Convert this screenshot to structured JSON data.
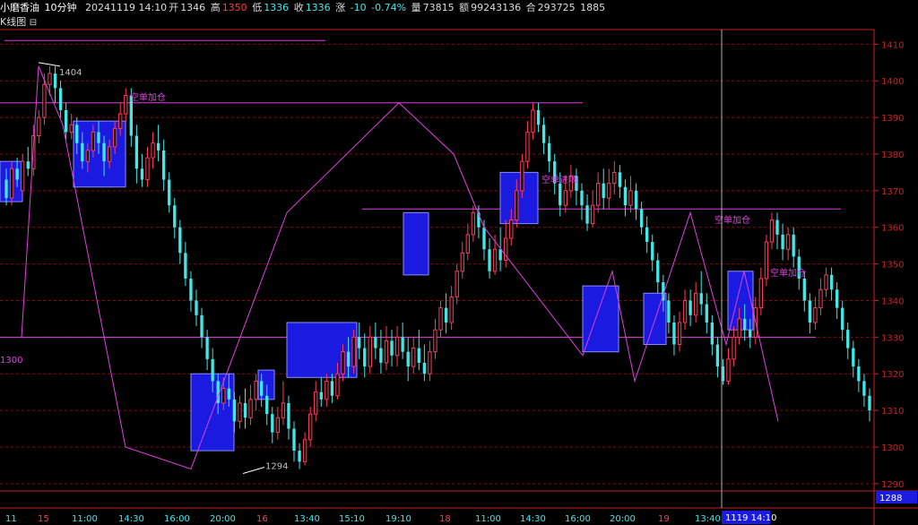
{
  "header": {
    "symbol": "小磨香油",
    "period": "10分钟",
    "datetime": "20241119 14:10",
    "open_label": "开",
    "open": "1346",
    "high_label": "高",
    "high": "1350",
    "low_label": "低",
    "low": "1336",
    "close_label": "收",
    "close": "1336",
    "change_label": "涨",
    "change": "-10",
    "change_pct": "-0.74%",
    "volume_label": "量",
    "volume": "73815",
    "amount_label": "额",
    "amount": "99243136",
    "oi_label": "合",
    "oi": "293725",
    "extra": "1885"
  },
  "subhead": {
    "title": "K线图",
    "icon": "window-icon"
  },
  "colors": {
    "up": "#ff3c5c",
    "down": "#40e8e8",
    "box_fill": "#1a1ae0",
    "box_edge": "#8c8cff",
    "magenta": "#e040e0",
    "axis": "#cc2222",
    "grid": "#7a1010",
    "text_grey": "#c0c0c0"
  },
  "chart_data": {
    "type": "candlestick",
    "title": "",
    "ylim": [
      1288,
      1414
    ],
    "yticks": [
      1290,
      1300,
      1310,
      1320,
      1330,
      1340,
      1350,
      1360,
      1370,
      1380,
      1390,
      1400,
      1410
    ],
    "current_price_label": "1288",
    "left_value_label": "1300",
    "xticks": [
      "11",
      "15",
      "11:00",
      "14:30",
      "16:00",
      "20:00",
      "16",
      "13:40",
      "15:10",
      "19:10",
      "18",
      "11:00",
      "14:30",
      "16:00",
      "20:00",
      "19",
      "13:40"
    ],
    "crosshair_label": "1119 14:10",
    "peak_labels": [
      {
        "text": "1404",
        "price": 1404
      },
      {
        "text": "1294",
        "price": 1294
      }
    ],
    "annotations": [
      "空单加仓",
      "空单进场",
      "空单加仓",
      "空单加仓"
    ],
    "horizontal_lines": [
      1411,
      1394,
      1365,
      1330
    ],
    "zigzag": [
      1330,
      1404,
      1388,
      1300,
      1294,
      1332,
      1364,
      1394,
      1380,
      1360,
      1325,
      1348,
      1318,
      1364,
      1328,
      1348,
      1307
    ],
    "boxes": [
      {
        "y_low": 1367,
        "y_high": 1378
      },
      {
        "y_low": 1371,
        "y_high": 1389
      },
      {
        "y_low": 1299,
        "y_high": 1320
      },
      {
        "y_low": 1313,
        "y_high": 1321
      },
      {
        "y_low": 1319,
        "y_high": 1334
      },
      {
        "y_low": 1347,
        "y_high": 1364
      },
      {
        "y_low": 1361,
        "y_high": 1375
      },
      {
        "y_low": 1326,
        "y_high": 1344
      },
      {
        "y_low": 1328,
        "y_high": 1342
      },
      {
        "y_low": 1332,
        "y_high": 1348
      }
    ],
    "candles": [
      [
        1373,
        1368,
        1376,
        1366
      ],
      [
        1368,
        1376,
        1378,
        1366
      ],
      [
        1376,
        1373,
        1379,
        1371
      ],
      [
        1370,
        1378,
        1380,
        1368
      ],
      [
        1378,
        1376,
        1382,
        1374
      ],
      [
        1376,
        1385,
        1388,
        1374
      ],
      [
        1385,
        1390,
        1392,
        1383
      ],
      [
        1390,
        1399,
        1402,
        1388
      ],
      [
        1399,
        1402,
        1404,
        1396
      ],
      [
        1402,
        1398,
        1404,
        1394
      ],
      [
        1398,
        1392,
        1400,
        1390
      ],
      [
        1392,
        1386,
        1394,
        1384
      ],
      [
        1386,
        1388,
        1391,
        1384
      ],
      [
        1388,
        1383,
        1390,
        1380
      ],
      [
        1383,
        1378,
        1386,
        1376
      ],
      [
        1378,
        1381,
        1383,
        1375
      ],
      [
        1381,
        1386,
        1388,
        1379
      ],
      [
        1386,
        1383,
        1389,
        1380
      ],
      [
        1383,
        1378,
        1385,
        1374
      ],
      [
        1378,
        1382,
        1384,
        1376
      ],
      [
        1382,
        1387,
        1389,
        1380
      ],
      [
        1387,
        1391,
        1394,
        1385
      ],
      [
        1391,
        1396,
        1398,
        1389
      ],
      [
        1396,
        1385,
        1398,
        1382
      ],
      [
        1385,
        1376,
        1388,
        1372
      ],
      [
        1376,
        1373,
        1380,
        1371
      ],
      [
        1373,
        1379,
        1382,
        1371
      ],
      [
        1379,
        1383,
        1386,
        1376
      ],
      [
        1383,
        1381,
        1388,
        1378
      ],
      [
        1381,
        1373,
        1384,
        1370
      ],
      [
        1373,
        1366,
        1375,
        1364
      ],
      [
        1366,
        1360,
        1368,
        1357
      ],
      [
        1360,
        1353,
        1362,
        1350
      ],
      [
        1353,
        1346,
        1356,
        1344
      ],
      [
        1346,
        1340,
        1348,
        1337
      ],
      [
        1340,
        1336,
        1343,
        1333
      ],
      [
        1336,
        1330,
        1338,
        1327
      ],
      [
        1330,
        1324,
        1332,
        1321
      ],
      [
        1324,
        1318,
        1327,
        1315
      ],
      [
        1318,
        1312,
        1320,
        1309
      ],
      [
        1312,
        1316,
        1319,
        1310
      ],
      [
        1316,
        1313,
        1320,
        1311
      ],
      [
        1313,
        1307,
        1315,
        1304
      ],
      [
        1307,
        1312,
        1314,
        1305
      ],
      [
        1312,
        1308,
        1316,
        1305
      ],
      [
        1308,
        1313,
        1317,
        1306
      ],
      [
        1313,
        1318,
        1320,
        1310
      ],
      [
        1318,
        1314,
        1320,
        1311
      ],
      [
        1314,
        1309,
        1317,
        1306
      ],
      [
        1309,
        1304,
        1311,
        1301
      ],
      [
        1304,
        1308,
        1311,
        1302
      ],
      [
        1308,
        1312,
        1318,
        1306
      ],
      [
        1312,
        1305,
        1314,
        1302
      ],
      [
        1305,
        1299,
        1307,
        1296
      ],
      [
        1299,
        1296,
        1301,
        1294
      ],
      [
        1296,
        1302,
        1304,
        1295
      ],
      [
        1302,
        1309,
        1311,
        1300
      ],
      [
        1309,
        1315,
        1318,
        1307
      ],
      [
        1315,
        1313,
        1319,
        1311
      ],
      [
        1313,
        1318,
        1320,
        1311
      ],
      [
        1318,
        1314,
        1320,
        1312
      ],
      [
        1314,
        1320,
        1323,
        1313
      ],
      [
        1320,
        1326,
        1328,
        1318
      ],
      [
        1326,
        1322,
        1330,
        1319
      ],
      [
        1322,
        1330,
        1332,
        1320
      ],
      [
        1330,
        1327,
        1334,
        1324
      ],
      [
        1327,
        1322,
        1331,
        1319
      ],
      [
        1322,
        1330,
        1333,
        1320
      ],
      [
        1330,
        1327,
        1334,
        1324
      ],
      [
        1327,
        1323,
        1332,
        1320
      ],
      [
        1323,
        1329,
        1333,
        1321
      ],
      [
        1329,
        1325,
        1332,
        1322
      ],
      [
        1325,
        1330,
        1333,
        1322
      ],
      [
        1330,
        1326,
        1334,
        1324
      ],
      [
        1326,
        1322,
        1330,
        1318
      ],
      [
        1322,
        1327,
        1330,
        1320
      ],
      [
        1327,
        1323,
        1332,
        1321
      ],
      [
        1323,
        1320,
        1328,
        1318
      ],
      [
        1320,
        1326,
        1329,
        1318
      ],
      [
        1326,
        1332,
        1335,
        1324
      ],
      [
        1332,
        1338,
        1340,
        1330
      ],
      [
        1338,
        1334,
        1342,
        1331
      ],
      [
        1334,
        1341,
        1344,
        1332
      ],
      [
        1341,
        1348,
        1350,
        1339
      ],
      [
        1348,
        1353,
        1356,
        1346
      ],
      [
        1353,
        1358,
        1361,
        1351
      ],
      [
        1358,
        1364,
        1366,
        1356
      ],
      [
        1364,
        1360,
        1366,
        1357
      ],
      [
        1360,
        1354,
        1362,
        1351
      ],
      [
        1354,
        1348,
        1357,
        1346
      ],
      [
        1348,
        1354,
        1358,
        1347
      ],
      [
        1354,
        1351,
        1360,
        1348
      ],
      [
        1351,
        1357,
        1362,
        1349
      ],
      [
        1357,
        1362,
        1365,
        1355
      ],
      [
        1362,
        1370,
        1373,
        1360
      ],
      [
        1370,
        1378,
        1380,
        1368
      ],
      [
        1378,
        1386,
        1389,
        1376
      ],
      [
        1386,
        1392,
        1394,
        1384
      ],
      [
        1392,
        1388,
        1394,
        1386
      ],
      [
        1388,
        1383,
        1390,
        1380
      ],
      [
        1383,
        1378,
        1385,
        1375
      ],
      [
        1378,
        1372,
        1380,
        1369
      ],
      [
        1372,
        1366,
        1375,
        1363
      ],
      [
        1366,
        1370,
        1374,
        1364
      ],
      [
        1370,
        1374,
        1377,
        1368
      ],
      [
        1374,
        1370,
        1376,
        1366
      ],
      [
        1370,
        1366,
        1372,
        1362
      ],
      [
        1366,
        1361,
        1369,
        1359
      ],
      [
        1361,
        1366,
        1370,
        1360
      ],
      [
        1366,
        1372,
        1375,
        1364
      ],
      [
        1372,
        1368,
        1376,
        1365
      ],
      [
        1368,
        1372,
        1376,
        1365
      ],
      [
        1372,
        1375,
        1378,
        1369
      ],
      [
        1375,
        1371,
        1377,
        1368
      ],
      [
        1371,
        1366,
        1373,
        1363
      ],
      [
        1366,
        1370,
        1374,
        1364
      ],
      [
        1370,
        1365,
        1372,
        1362
      ],
      [
        1365,
        1360,
        1367,
        1358
      ],
      [
        1360,
        1356,
        1363,
        1353
      ],
      [
        1356,
        1351,
        1358,
        1348
      ],
      [
        1351,
        1345,
        1353,
        1342
      ],
      [
        1345,
        1340,
        1347,
        1337
      ],
      [
        1340,
        1334,
        1342,
        1331
      ],
      [
        1334,
        1328,
        1336,
        1325
      ],
      [
        1328,
        1334,
        1337,
        1326
      ],
      [
        1334,
        1340,
        1343,
        1332
      ],
      [
        1340,
        1336,
        1343,
        1333
      ],
      [
        1336,
        1342,
        1345,
        1334
      ],
      [
        1342,
        1339,
        1348,
        1336
      ],
      [
        1339,
        1334,
        1342,
        1331
      ],
      [
        1334,
        1328,
        1336,
        1325
      ],
      [
        1328,
        1322,
        1330,
        1319
      ],
      [
        1322,
        1318,
        1324,
        1317
      ],
      [
        1318,
        1324,
        1327,
        1317
      ],
      [
        1324,
        1330,
        1333,
        1322
      ],
      [
        1330,
        1335,
        1338,
        1328
      ],
      [
        1335,
        1332,
        1339,
        1329
      ],
      [
        1332,
        1330,
        1335,
        1327
      ],
      [
        1330,
        1338,
        1341,
        1328
      ],
      [
        1338,
        1346,
        1349,
        1336
      ],
      [
        1346,
        1356,
        1358,
        1344
      ],
      [
        1356,
        1362,
        1364,
        1354
      ],
      [
        1362,
        1358,
        1364,
        1354
      ],
      [
        1358,
        1354,
        1361,
        1351
      ],
      [
        1354,
        1358,
        1360,
        1351
      ],
      [
        1358,
        1352,
        1360,
        1349
      ],
      [
        1352,
        1346,
        1354,
        1343
      ],
      [
        1346,
        1340,
        1348,
        1337
      ],
      [
        1340,
        1334,
        1342,
        1331
      ],
      [
        1334,
        1338,
        1341,
        1332
      ],
      [
        1338,
        1343,
        1346,
        1336
      ],
      [
        1343,
        1347,
        1349,
        1341
      ],
      [
        1347,
        1343,
        1349,
        1340
      ],
      [
        1343,
        1338,
        1345,
        1335
      ],
      [
        1338,
        1332,
        1340,
        1329
      ],
      [
        1332,
        1327,
        1334,
        1324
      ],
      [
        1327,
        1322,
        1329,
        1319
      ],
      [
        1322,
        1318,
        1324,
        1315
      ],
      [
        1318,
        1314,
        1320,
        1311
      ],
      [
        1314,
        1310,
        1316,
        1307
      ]
    ]
  }
}
